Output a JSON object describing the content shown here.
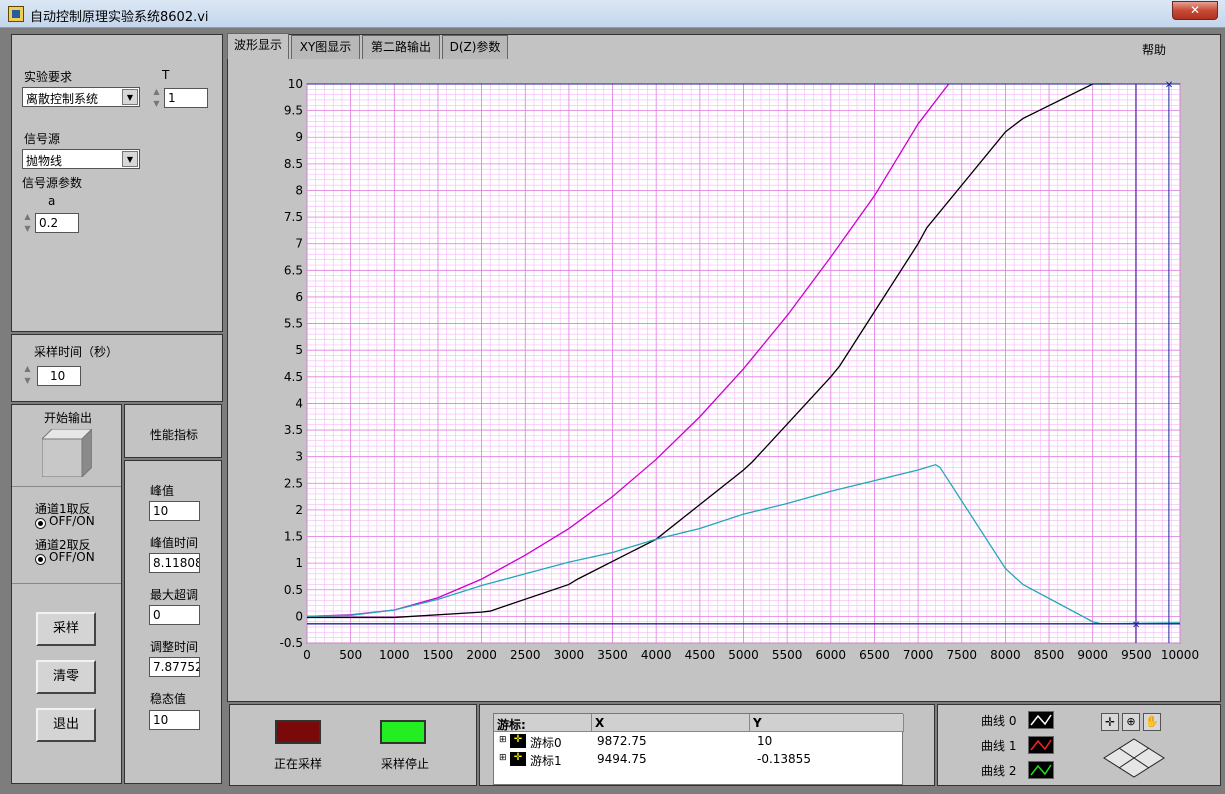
{
  "window": {
    "title": "自动控制原理实验系统8602.vi",
    "close_label": "✕"
  },
  "left": {
    "requirement_label": "实验要求",
    "requirement_value": "离散控制系统",
    "t_label": "T",
    "t_value": "1",
    "signal_label": "信号源",
    "signal_value": "抛物线",
    "signal_params_label": "信号源参数",
    "a_label": "a",
    "a_value": "0.2",
    "sample_time_label": "采样时间（秒）",
    "sample_time_value": "10",
    "start_output_label": "开始输出",
    "channel1_label": "通道1取反",
    "channel1_state": "OFF/ON",
    "channel2_label": "通道2取反",
    "channel2_state": "OFF/ON",
    "sample_btn": "采样",
    "clear_btn": "清零",
    "exit_btn": "退出"
  },
  "performance": {
    "header": "性能指标",
    "peak_label": "峰值",
    "peak_value": "10",
    "peak_time_label": "峰值时间",
    "peak_time_value": "8.11808",
    "overshoot_label": "最大超调",
    "overshoot_value": "0",
    "settling_label": "调整时间",
    "settling_value": "7.87752",
    "steady_label": "稳态值",
    "steady_value": "10"
  },
  "tabs": [
    {
      "label": "波形显示"
    },
    {
      "label": "XY图显示"
    },
    {
      "label": "第二路输出"
    },
    {
      "label": "D(Z)参数"
    }
  ],
  "help_label": "帮助",
  "status": {
    "sampling_label": "正在采样",
    "stopped_label": "采样停止",
    "sampling_color": "#7a0a0a",
    "stopped_color": "#22ee22"
  },
  "cursors": {
    "headers": [
      "游标:",
      "X",
      "Y"
    ],
    "rows": [
      {
        "name": "游标0",
        "x": "9872.75",
        "y": "10"
      },
      {
        "name": "游标1",
        "x": "9494.75",
        "y": "-0.13855"
      }
    ]
  },
  "legend": [
    {
      "label": "曲线 0",
      "color": "#ffffff"
    },
    {
      "label": "曲线 1",
      "color": "#ff2020"
    },
    {
      "label": "曲线 2",
      "color": "#20e020"
    }
  ],
  "chart_data": {
    "type": "line",
    "xlim": [
      0,
      10000
    ],
    "ylim": [
      -0.5,
      10
    ],
    "x_ticks": [
      0,
      500,
      1000,
      1500,
      2000,
      2500,
      3000,
      3500,
      4000,
      4500,
      5000,
      5500,
      6000,
      6500,
      7000,
      7500,
      8000,
      8500,
      9000,
      9500,
      10000
    ],
    "y_ticks": [
      -0.5,
      0,
      0.5,
      1,
      1.5,
      2,
      2.5,
      3,
      3.5,
      4,
      4.5,
      5,
      5.5,
      6,
      6.5,
      7,
      7.5,
      8,
      8.5,
      9,
      9.5,
      10
    ],
    "grid": true,
    "series": [
      {
        "color": "#cc00cc",
        "x": [
          0,
          500,
          1000,
          1500,
          2000,
          2500,
          3000,
          3500,
          4000,
          4500,
          5000,
          5500,
          6000,
          6500,
          7000,
          7350
        ],
        "y": [
          0,
          0.03,
          0.12,
          0.35,
          0.7,
          1.15,
          1.65,
          2.25,
          2.95,
          3.75,
          4.65,
          5.65,
          6.75,
          7.9,
          9.25,
          10
        ]
      },
      {
        "color": "#000000",
        "x": [
          0,
          1000,
          2000,
          2100,
          3000,
          3100,
          4000,
          5000,
          5100,
          6000,
          6100,
          7000,
          7100,
          8000,
          8200,
          9000,
          9200
        ],
        "y": [
          -0.02,
          -0.02,
          0.08,
          0.1,
          0.6,
          0.7,
          1.45,
          2.75,
          2.9,
          4.5,
          4.7,
          7.0,
          7.3,
          9.1,
          9.35,
          10,
          10
        ]
      },
      {
        "color": "#20a8b8",
        "x": [
          0,
          500,
          1000,
          1500,
          2000,
          2500,
          3000,
          3500,
          4000,
          4500,
          5000,
          5500,
          6000,
          6500,
          7000,
          7200,
          7250,
          8000,
          8200,
          9000,
          9100,
          10000
        ],
        "y": [
          0,
          0.02,
          0.12,
          0.32,
          0.58,
          0.8,
          1.02,
          1.2,
          1.45,
          1.65,
          1.92,
          2.12,
          2.35,
          2.55,
          2.75,
          2.85,
          2.8,
          0.9,
          0.6,
          -0.1,
          -0.14,
          -0.12
        ]
      },
      {
        "color": "#2020a0",
        "x": [
          0,
          10000
        ],
        "y": [
          -0.14,
          -0.14
        ]
      }
    ],
    "cursor_lines": [
      9872.75,
      9494.75
    ]
  }
}
